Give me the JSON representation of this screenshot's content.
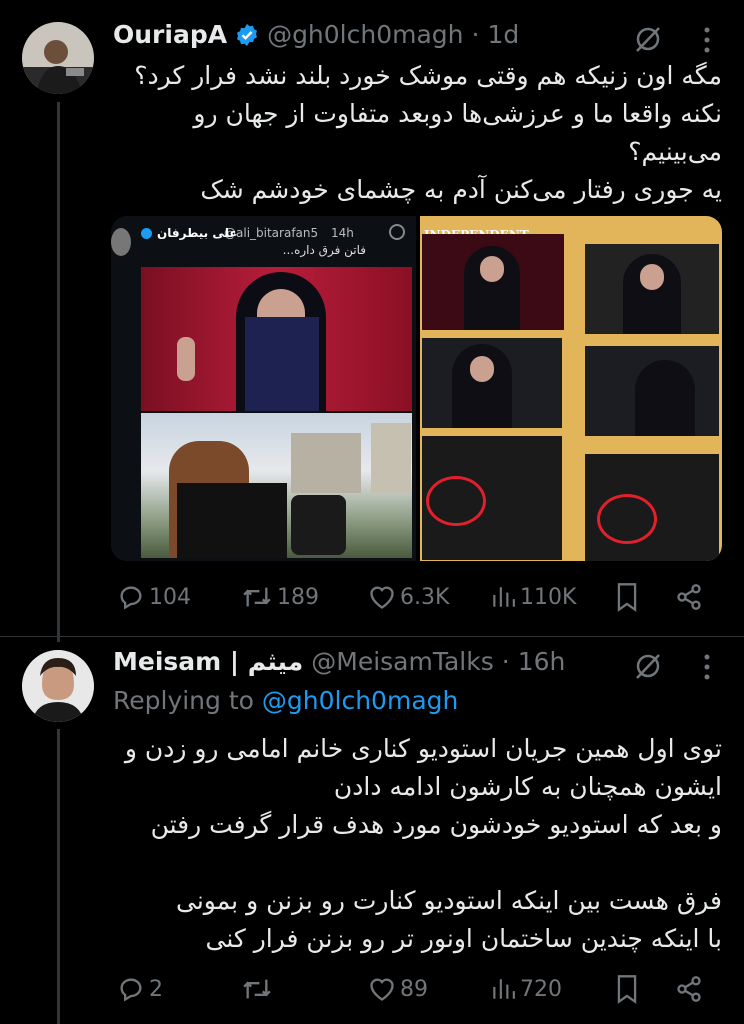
{
  "tweet1": {
    "display_name": "OuriapA",
    "handle": "@gh0lch0magh",
    "separator": "·",
    "time": "1d",
    "lines": [
      "مگه اون زنیکه هم وقتی موشک خورد بلند نشد فرار کرد؟",
      "نکنه واقعا ما و عرزشی‌ها دوبعد متفاوت از جهان رو",
      "می‌بینیم؟",
      "یه جوری رفتار می‌کنن آدم به چشمای خودشم شک می‌کنه!"
    ],
    "quoted": {
      "name": "علی بیطرفان",
      "handle": "@ali_bitarafan5",
      "time": "14h",
      "text": "فاتن فرق داره..."
    },
    "collage_label": "INDEPENDENT",
    "stats": {
      "replies": "104",
      "reposts": "189",
      "likes": "6.3K",
      "views": "110K"
    }
  },
  "tweet2": {
    "display_name": "Meisam | میثم",
    "handle": "@MeisamTalks",
    "separator": "·",
    "time": "16h",
    "replying_label": "Replying to",
    "replying_to": "@gh0lch0magh",
    "lines": [
      "توی اول همین جریان استودیو کناری خانم امامی رو زدن و",
      "ایشون همچنان به کارشون ادامه دادن",
      "و بعد که استودیو خودشون مورد هدف قرار گرفت رفتن",
      "",
      "فرق هست بین اینکه استودیو کنارت رو بزنن و بمونی",
      "با اینکه چندین ساختمان اونور تر رو بزنن فرار کنی"
    ],
    "stats": {
      "replies": "2",
      "reposts": "",
      "likes": "89",
      "views": "720"
    }
  },
  "colors": {
    "background": "#000000",
    "text": "#e7e9ea",
    "muted": "#71767b",
    "accent": "#1d9bf0",
    "divider": "#2f3336"
  }
}
